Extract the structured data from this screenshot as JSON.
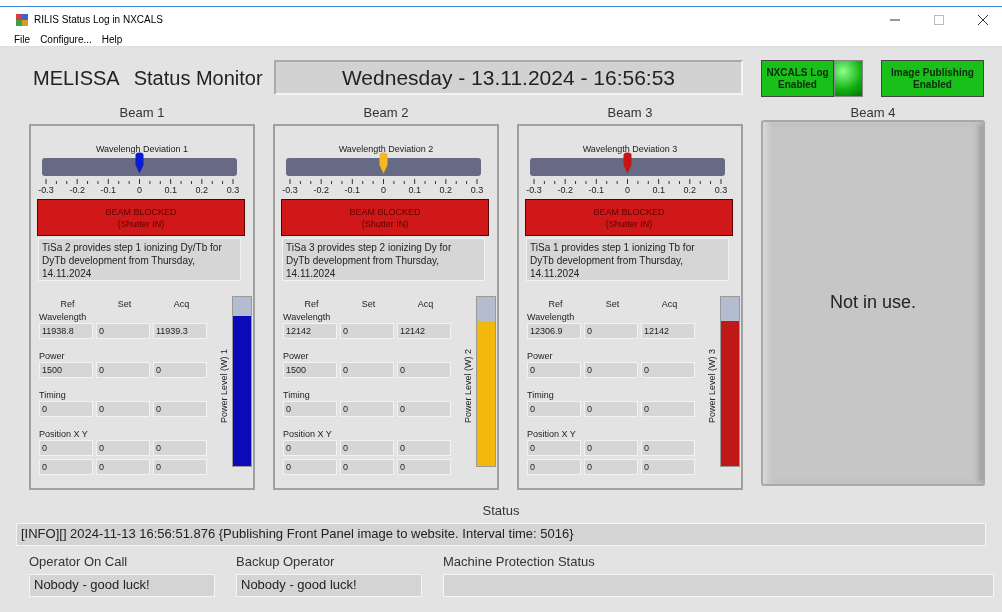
{
  "window": {
    "title": "RILIS Status Log in NXCALS"
  },
  "menu": [
    "File",
    "Configure...",
    "Help"
  ],
  "header": {
    "title": "MELISSA",
    "subtitle": "Status Monitor",
    "datetime": "Wednesday - 13.11.2024 - 16:56:53"
  },
  "toggles": [
    {
      "lines": [
        "NXCALS Log",
        "Enabled"
      ],
      "on": true,
      "led": true
    },
    {
      "lines": [
        "Image Publishing",
        "Enabled"
      ],
      "on": true,
      "led": false
    }
  ],
  "beams": [
    {
      "kind": "active",
      "label": "Beam 1",
      "slider": {
        "label": "Wavelengh Deviation 1",
        "level": 0.5,
        "color": "#0a1ad0",
        "scale": [
          "-0.3",
          "-0.2",
          "-0.1",
          "0",
          "0.1",
          "0.2",
          "0.3"
        ]
      },
      "shutter": {
        "blocked": true,
        "lines": [
          "BEAM BLOCKED",
          "(Shutter IN)"
        ]
      },
      "note": "TiSa 2 provides step 1 ionizing Dy/Tb for DyTb development from Thursday, 14.11.2024",
      "columns": [
        "Ref",
        "Set",
        "Acq"
      ],
      "groups": [
        {
          "label": "Wavelength",
          "rows": [
            [
              "11938.8",
              "0",
              "11939.3"
            ]
          ]
        },
        {
          "label": "Power",
          "rows": [
            [
              "1500",
              "0",
              "0"
            ]
          ]
        },
        {
          "label": "Timing",
          "rows": [
            [
              "0",
              "0",
              "0"
            ]
          ]
        },
        {
          "label": "Position X Y",
          "rows": [
            [
              "0",
              "0",
              "0"
            ],
            [
              "0",
              "0",
              "0"
            ]
          ]
        }
      ],
      "power": {
        "label": "Power Level (W) 1",
        "level": 0.89,
        "color": "#0a0ab8"
      }
    },
    {
      "kind": "active",
      "label": "Beam 2",
      "slider": {
        "label": "Wavelength Deviation 2",
        "level": 0.5,
        "color": "#f5b820",
        "scale": [
          "-0.3",
          "-0.2",
          "-0.1",
          "0",
          "0.1",
          "0.2",
          "0.3"
        ]
      },
      "shutter": {
        "blocked": true,
        "lines": [
          "BEAM BLOCKED",
          "(Shutter IN)"
        ]
      },
      "note": "TiSa 3 provides step 2 ionizing Dy for DyTb development from Thursday, 14.11.2024",
      "columns": [
        "Ref",
        "Set",
        "Acq"
      ],
      "groups": [
        {
          "label": "Wavelength",
          "rows": [
            [
              "12142",
              "0",
              "12142"
            ]
          ]
        },
        {
          "label": "Power",
          "rows": [
            [
              "1500",
              "0",
              "0"
            ]
          ]
        },
        {
          "label": "Timing",
          "rows": [
            [
              "0",
              "0",
              "0"
            ]
          ]
        },
        {
          "label": "Position X Y",
          "rows": [
            [
              "0",
              "0",
              "0"
            ],
            [
              "0",
              "0",
              "0"
            ]
          ]
        }
      ],
      "power": {
        "label": "Power Level (W) 2",
        "level": 0.86,
        "color": "#f2b90c"
      }
    },
    {
      "kind": "active",
      "label": "Beam 3",
      "slider": {
        "label": "Wavelength Deviation 3",
        "level": 0.5,
        "color": "#c81414",
        "scale": [
          "-0.3",
          "-0.2",
          "-0.1",
          "0",
          "0.1",
          "0.2",
          "0.3"
        ]
      },
      "shutter": {
        "blocked": true,
        "lines": [
          "BEAM BLOCKED",
          "(Shutter IN)"
        ]
      },
      "note": "TiSa 1 provides step 1 ionizing Tb for DyTb development from Thursday, 14.11.2024",
      "columns": [
        "Ref",
        "Set",
        "Acq"
      ],
      "groups": [
        {
          "label": "Wavelength",
          "rows": [
            [
              "12306.9",
              "0",
              "12142"
            ]
          ]
        },
        {
          "label": "Power",
          "rows": [
            [
              "0",
              "0",
              "0"
            ]
          ]
        },
        {
          "label": "Timing",
          "rows": [
            [
              "0",
              "0",
              "0"
            ]
          ]
        },
        {
          "label": "Position X Y",
          "rows": [
            [
              "0",
              "0",
              "0"
            ],
            [
              "0",
              "0",
              "0"
            ]
          ]
        }
      ],
      "power": {
        "label": "Power Level (W) 3",
        "level": 0.86,
        "color": "#c01818"
      }
    },
    {
      "kind": "unused",
      "label": "Beam 4",
      "message": "Not in use."
    }
  ],
  "status": {
    "label": "Status",
    "text": "[INFO][] 2024-11-13 16:56:51.876 {Publishing Front Panel image to website. Interval time: 5016}"
  },
  "fields": [
    {
      "label": "Operator On Call",
      "value": "Nobody - good luck!"
    },
    {
      "label": "Backup Operator",
      "value": "Nobody - good luck!"
    },
    {
      "label": "Machine Protection Status"
    }
  ]
}
